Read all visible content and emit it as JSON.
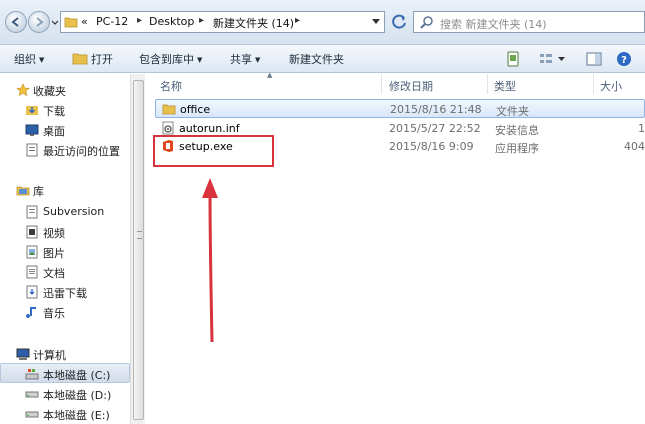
{
  "address_bar": {
    "overflow": "«",
    "crumbs": [
      "PC-12",
      "Desktop",
      "新建文件夹 (14)"
    ],
    "search_placeholder": "搜索 新建文件夹 (14)"
  },
  "toolbar": {
    "organize": "组织",
    "open": "打开",
    "include_in_library": "包含到库中",
    "share": "共享",
    "new_folder": "新建文件夹"
  },
  "nav": {
    "favorites": {
      "header": "收藏夹",
      "items": [
        "下载",
        "桌面",
        "最近访问的位置"
      ]
    },
    "libraries": {
      "header": "库",
      "items": [
        "Subversion",
        "视频",
        "图片",
        "文档",
        "迅雷下载",
        "音乐"
      ]
    },
    "computer": {
      "header": "计算机",
      "items": [
        "本地磁盘 (C:)",
        "本地磁盘 (D:)",
        "本地磁盘 (E:)"
      ]
    }
  },
  "columns": {
    "name": "名称",
    "date": "修改日期",
    "type": "类型",
    "size": "大小"
  },
  "files": [
    {
      "name": "office",
      "date": "2015/8/16 21:48",
      "type": "文件夹",
      "size": "",
      "icon": "folder-icon"
    },
    {
      "name": "autorun.inf",
      "date": "2015/5/27 22:52",
      "type": "安装信息",
      "size": "1",
      "icon": "settings-file-icon"
    },
    {
      "name": "setup.exe",
      "date": "2015/8/16 9:09",
      "type": "应用程序",
      "size": "404",
      "icon": "office-icon"
    }
  ],
  "colors": {
    "annotation": "#d8323c",
    "selection": "#d8e7fa"
  }
}
